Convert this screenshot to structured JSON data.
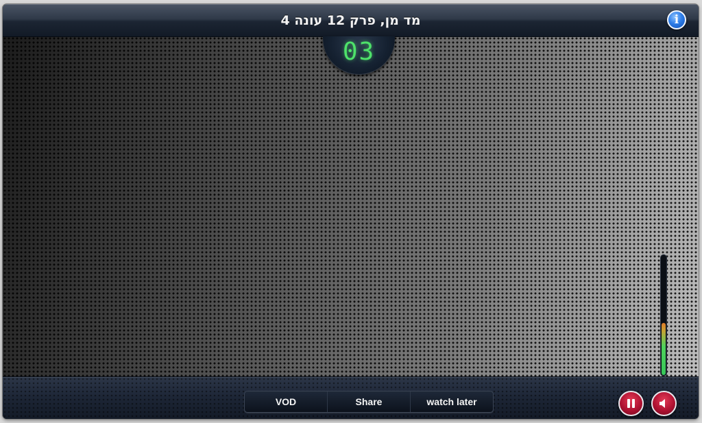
{
  "title_bar": {
    "title": "מד מן, פרק 12 עונה 4"
  },
  "counter": {
    "value": "03",
    "color": "#4ee26a"
  },
  "level_meter": {
    "level_fraction": 0.43
  },
  "bottom_bar": {
    "tabs": [
      {
        "label": "VOD"
      },
      {
        "label": "Share"
      },
      {
        "label": "watch later"
      }
    ]
  },
  "icons": {
    "info": "info-icon",
    "pause": "pause-icon",
    "volume": "speaker-icon"
  },
  "colors": {
    "accent_red": "#b01232",
    "info_blue": "#2f7ee8",
    "meter_green": "#37c75a",
    "meter_orange": "#e07a2a"
  }
}
